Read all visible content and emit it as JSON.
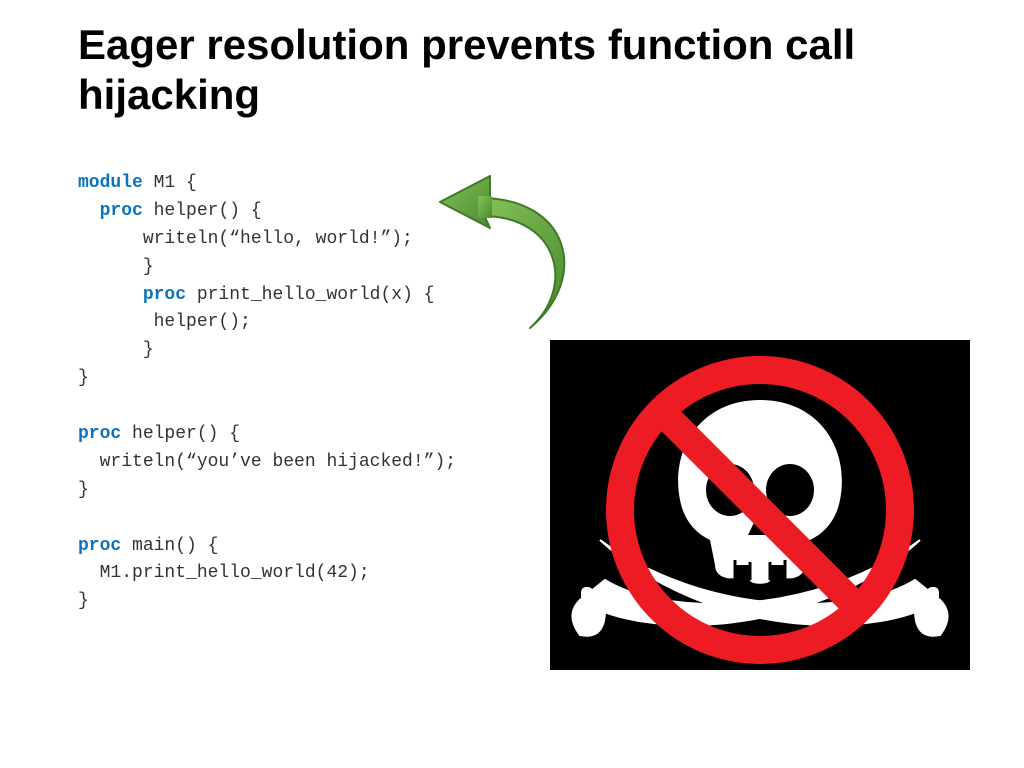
{
  "title": "Eager resolution prevents function call hijacking",
  "code": {
    "l1_kw": "module",
    "l1_rest": " M1 {",
    "l2_kw": "proc",
    "l2_rest": " helper() {",
    "l3": "writeln(“hello, world!”);",
    "l4": "}",
    "l5_kw": "proc",
    "l5_rest": " print_hello_world(x) {",
    "l6": "helper();",
    "l7": "}",
    "l8": "}",
    "l10_kw": "proc",
    "l10_rest": " helper() {",
    "l11": "writeln(“you’ve been hijacked!”);",
    "l12": "}",
    "l14_kw": "proc",
    "l14_rest": " main() {",
    "l15": "M1.print_hello_world(42);",
    "l16": "}"
  },
  "icons": {
    "arrow": "curved-arrow-icon",
    "no_pirate": "no-piracy-icon"
  },
  "colors": {
    "keyword": "#0b74bd",
    "arrow_fill": "#5a9e3e",
    "arrow_stroke": "#3e7a28",
    "prohibit": "#ed1c24",
    "skull": "#ffffff",
    "bg_black": "#000000"
  }
}
